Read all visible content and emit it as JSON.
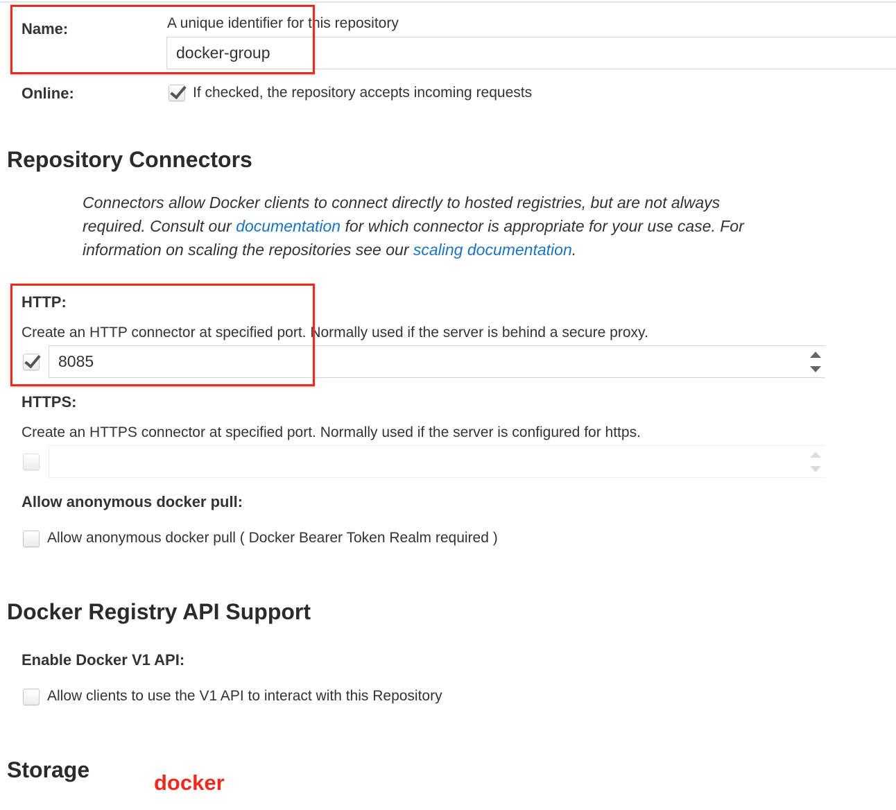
{
  "name_field": {
    "label": "Name:",
    "help": "A unique identifier for this repository",
    "value": "docker-group"
  },
  "online_field": {
    "label": "Online:",
    "help": "If checked, the repository accepts incoming requests",
    "checked": true
  },
  "connectors": {
    "heading": "Repository Connectors",
    "desc_part1": "Connectors allow Docker clients to connect directly to hosted registries, but are not always required. Consult our ",
    "link_documentation": "documentation",
    "desc_part2": " for which connector is appropriate for your use case. For information on scaling the repositories see our ",
    "link_scaling": "scaling documentation",
    "desc_part3": ".",
    "http": {
      "label": "HTTP:",
      "help": "Create an HTTP connector at specified port. Normally used if the server is behind a secure proxy.",
      "checked": true,
      "value": "8085"
    },
    "https": {
      "label": "HTTPS:",
      "help": "Create an HTTPS connector at specified port. Normally used if the server is configured for https.",
      "checked": false,
      "value": ""
    },
    "anonymous": {
      "label": "Allow anonymous docker pull:",
      "checkbox_label": "Allow anonymous docker pull ( Docker Bearer Token Realm required )",
      "checked": false
    }
  },
  "api_support": {
    "heading": "Docker Registry API Support",
    "v1": {
      "label": "Enable Docker V1 API:",
      "checkbox_label": "Allow clients to use the V1 API to interact with this Repository",
      "checked": false
    }
  },
  "storage": {
    "heading": "Storage"
  },
  "annotation": {
    "text": "docker",
    "color": "#ee2a1e"
  },
  "colors": {
    "link": "#1a73c2",
    "highlight": "#ee2a1e"
  }
}
